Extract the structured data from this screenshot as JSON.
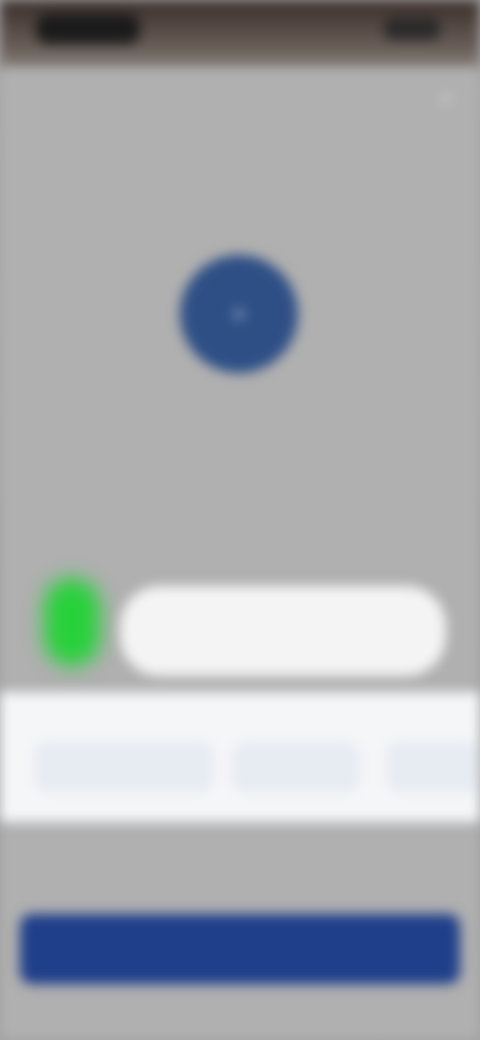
{
  "status_bar": {
    "time": "",
    "icons": "status-icons"
  },
  "card": {
    "close_icon": "close-icon",
    "headline": "",
    "avatar_icon": "plus-icon",
    "avatar_caption": ""
  },
  "assistant": {
    "bubble_text": ""
  },
  "sheet": {
    "title": "",
    "chips": [
      {
        "label": ""
      },
      {
        "label": ""
      },
      {
        "label": ""
      }
    ]
  },
  "footer": {
    "links_text": "",
    "primary_button_label": ""
  }
}
